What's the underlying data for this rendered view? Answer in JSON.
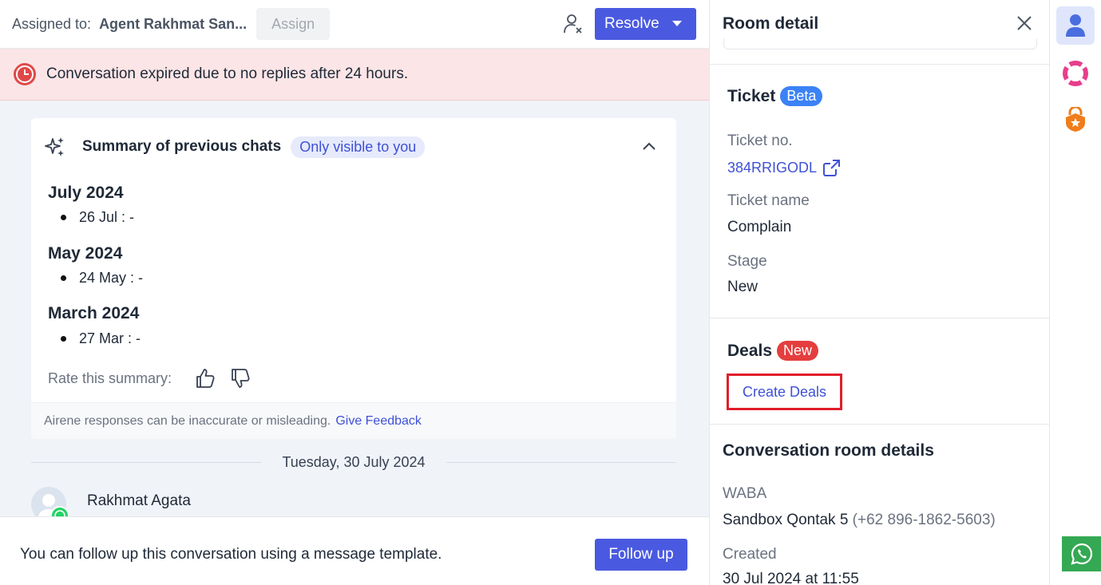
{
  "topbar": {
    "assigned_label": "Assigned to:",
    "assigned_name": "Agent Rakhmat San...",
    "assign_label": "Assign",
    "resolve_label": "Resolve"
  },
  "expired_banner": {
    "text": "Conversation expired due to no replies after 24 hours."
  },
  "summary": {
    "title": "Summary of previous chats",
    "visibility_badge": "Only visible to you",
    "groups": [
      {
        "month": "July 2024",
        "item": "26 Jul : -"
      },
      {
        "month": "May 2024",
        "item": "24 May : -"
      },
      {
        "month": "March 2024",
        "item": "27 Mar : -"
      }
    ],
    "rate_label": "Rate this summary:",
    "disclaimer": "Airene responses can be inaccurate or misleading.",
    "feedback_link": "Give Feedback"
  },
  "chat": {
    "date_divider": "Tuesday, 30 July 2024",
    "sender_name": "Rakhmat Agata"
  },
  "followup": {
    "text": "You can follow up this conversation using a message template.",
    "button_label": "Follow up"
  },
  "room_detail": {
    "title": "Room detail",
    "ticket": {
      "title": "Ticket",
      "badge": "Beta",
      "ticket_no_label": "Ticket no.",
      "ticket_no": "384RRIGODL",
      "ticket_name_label": "Ticket name",
      "ticket_name": "Complain",
      "stage_label": "Stage",
      "stage": "New"
    },
    "deals": {
      "title": "Deals",
      "badge": "New",
      "create_label": "Create Deals"
    },
    "conversation": {
      "title": "Conversation room details",
      "waba_label": "WABA",
      "waba_name": "Sandbox Qontak 5",
      "waba_phone": "(+62 896-1862-5603)",
      "created_label": "Created",
      "created_value": "30 Jul 2024 at 11:55"
    }
  },
  "colors": {
    "primary": "#4a5ae0",
    "expired_bg": "#fbe5e6",
    "beta_badge": "#3b82f6",
    "new_badge": "#e53e3e",
    "highlight_box": "#e11d2a",
    "whatsapp": "#34a853"
  },
  "rail_icons": [
    "user-profile-icon",
    "lifebuoy-icon",
    "shield-badge-icon",
    "whatsapp-icon"
  ]
}
